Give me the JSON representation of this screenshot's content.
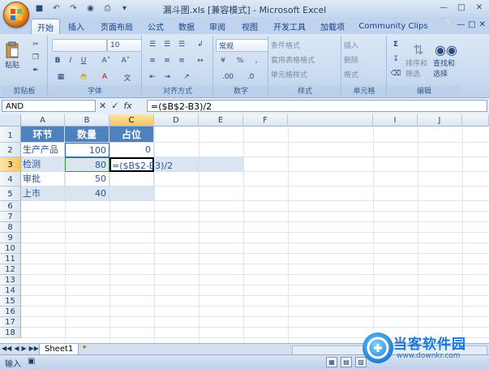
{
  "title_bar": {
    "title": "漏斗图.xls  [兼容模式] - Microsoft Excel"
  },
  "ribbon_tabs": [
    "开始",
    "插入",
    "页面布局",
    "公式",
    "数据",
    "审阅",
    "视图",
    "开发工具",
    "加载项",
    "Community Clips"
  ],
  "ribbon": {
    "clipboard": {
      "label": "剪贴板",
      "paste": "粘贴"
    },
    "font": {
      "label": "字体",
      "size": "10"
    },
    "alignment": {
      "label": "对齐方式"
    },
    "number": {
      "label": "数字",
      "format": "常规"
    },
    "styles": {
      "label": "样式",
      "cond_format": "条件格式",
      "table_format": "套用表格格式",
      "cell_styles": "单元格样式"
    },
    "cells": {
      "label": "单元格",
      "insert": "插入",
      "delete": "删除",
      "format": "格式"
    },
    "editing": {
      "label": "编辑",
      "sort_filter": "排序和筛选",
      "find_select": "查找和选择"
    }
  },
  "formula_bar": {
    "name_box": "AND",
    "formula": "=($B$2-B3)/2"
  },
  "columns": [
    "A",
    "B",
    "C",
    "D",
    "E",
    "F",
    "I",
    "J"
  ],
  "rows": [
    "1",
    "2",
    "3",
    "4",
    "5",
    "6",
    "7",
    "8",
    "9",
    "10",
    "11",
    "12",
    "13",
    "14",
    "15",
    "16",
    "17",
    "18"
  ],
  "cells": {
    "a1": "环节",
    "b1": "数量",
    "c1": "占位",
    "a2": "生产产品",
    "b2": "100",
    "c2": "0",
    "a3": "检测",
    "b3": "80",
    "c3": "=($B$2-B3)/2",
    "a4": "审批",
    "b4": "50",
    "a5": "上市",
    "b5": "40"
  },
  "sheet_tabs": [
    "Sheet1"
  ],
  "status": {
    "mode": "输入"
  },
  "watermark": {
    "brand": "当客软件园",
    "url": "www.downkr.com"
  }
}
